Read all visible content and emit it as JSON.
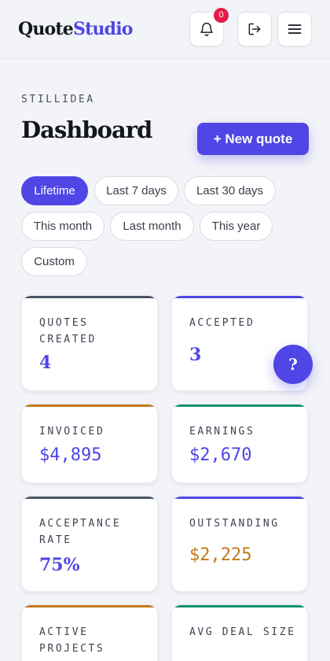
{
  "header": {
    "logo_primary": "Quote",
    "logo_accent": "Studio",
    "notification_count": "0"
  },
  "page": {
    "workspace": "STILLIDEA",
    "title": "Dashboard",
    "new_quote_label": "+ New quote"
  },
  "filters": {
    "active": "Lifetime",
    "items": [
      "Lifetime",
      "Last 7 days",
      "Last 30 days",
      "This month",
      "Last month",
      "This year",
      "Custom"
    ]
  },
  "stats": [
    {
      "label": "QUOTES CREATED",
      "value": "4",
      "accent": "#4b5563",
      "value_color": "#4f46e5"
    },
    {
      "label": "ACCEPTED",
      "value": "3",
      "accent": "#4f46e5",
      "value_color": "#4f46e5"
    },
    {
      "label": "INVOICED",
      "value": "$4,895",
      "accent": "#c27a1a",
      "value_color": "#4f46e5"
    },
    {
      "label": "EARNINGS",
      "value": "$2,670",
      "accent": "#12946a",
      "value_color": "#4f46e5"
    },
    {
      "label": "ACCEPTANCE RATE",
      "value": "75%",
      "accent": "#4b5563",
      "value_color": "#4f46e5"
    },
    {
      "label": "OUTSTANDING",
      "value": "$2,225",
      "accent": "#4f46e5",
      "value_color": "#c27a1a"
    },
    {
      "label": "ACTIVE PROJECTS",
      "value": "",
      "accent": "#c27a1a",
      "value_color": "#4f46e5"
    },
    {
      "label": "AVG DEAL SIZE",
      "value": "",
      "accent": "#12946a",
      "value_color": "#4f46e5"
    }
  ],
  "help_label": "?",
  "colors": {
    "brand": "#4f46e5",
    "background": "#f3f4f8",
    "badge": "#e11d48"
  },
  "icons": {
    "notifications": "bell-icon",
    "logout": "logout-icon",
    "menu": "menu-icon"
  }
}
